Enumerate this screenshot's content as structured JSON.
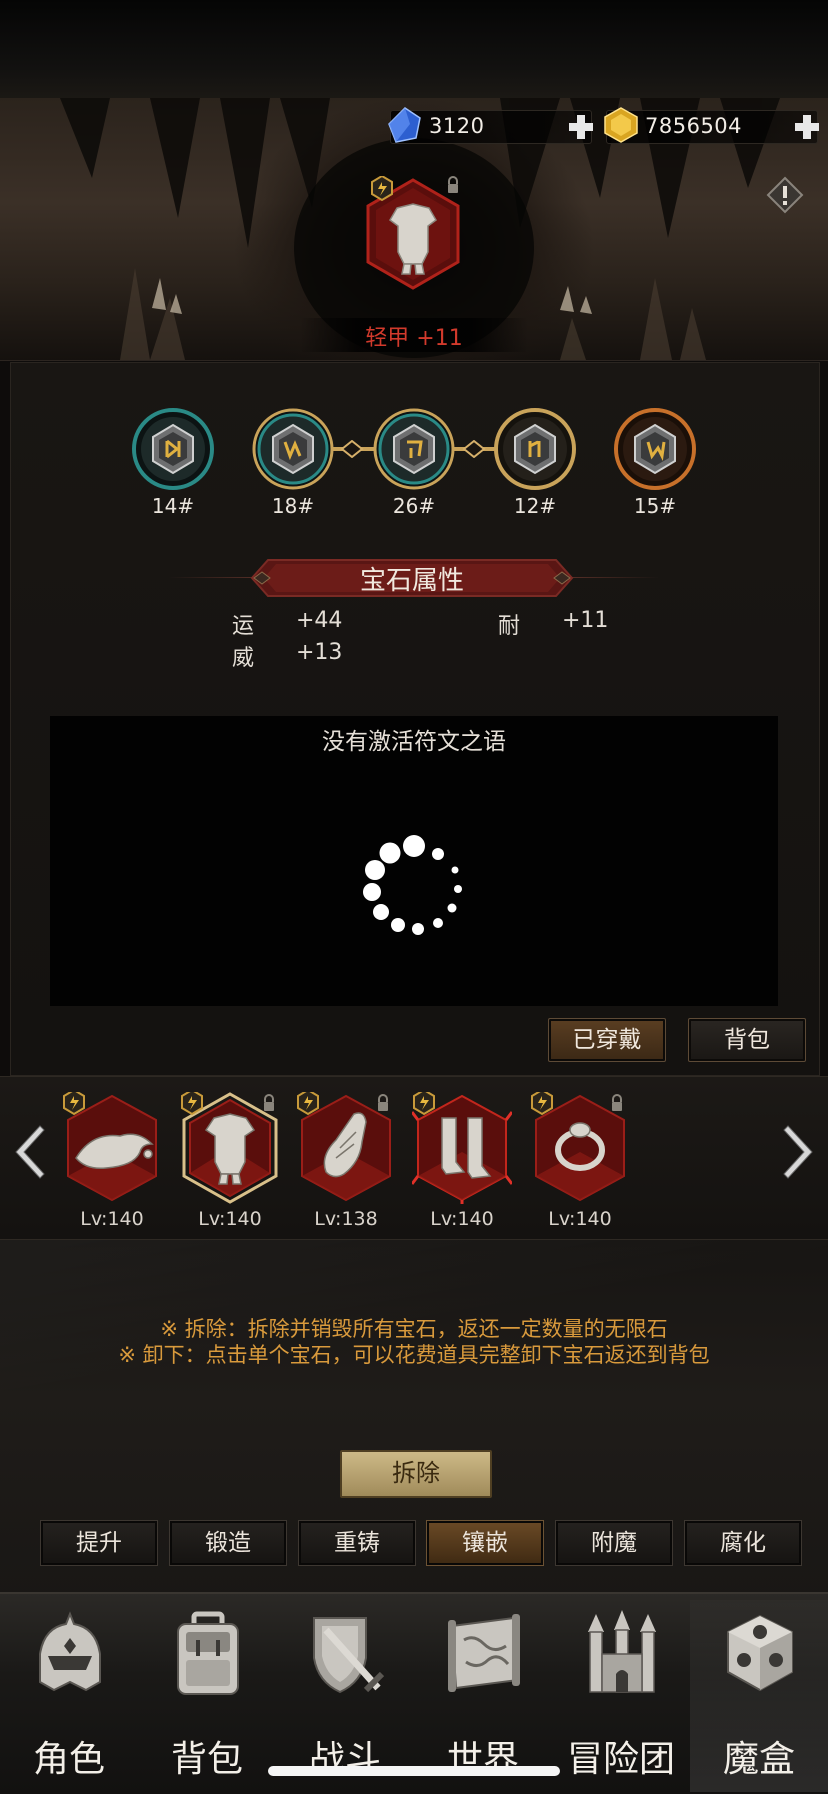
{
  "currency": {
    "diamond": {
      "value": "3120",
      "icon": "blue-crystal-icon"
    },
    "gold": {
      "value": "7856504",
      "icon": "gold-crystal-icon"
    }
  },
  "item": {
    "name": "轻甲 +11"
  },
  "gems": [
    {
      "label": "14#",
      "color": "#2a8a86"
    },
    {
      "label": "18#",
      "color": "#2a8a86"
    },
    {
      "label": "26#",
      "color": "#2a8a86"
    },
    {
      "label": "12#",
      "color": "#c9a35a"
    },
    {
      "label": "15#",
      "color": "#c7702a"
    }
  ],
  "gem_attributes": {
    "title": "宝石属性",
    "rows": [
      {
        "name": "运",
        "value": "+44"
      },
      {
        "name": "耐",
        "value": "+11"
      },
      {
        "name": "威",
        "value": "+13"
      }
    ]
  },
  "runes": {
    "text": "没有激活符文之语"
  },
  "buttons": {
    "equipped": "已穿戴",
    "bag": "背包",
    "remove": "拆除"
  },
  "equipment": [
    {
      "lv": "Lv:140",
      "icon": "wizard-hat-icon"
    },
    {
      "lv": "Lv:140",
      "icon": "chest-armor-icon"
    },
    {
      "lv": "Lv:138",
      "icon": "gauntlet-icon"
    },
    {
      "lv": "Lv:140",
      "icon": "boots-icon"
    },
    {
      "lv": "Lv:140",
      "icon": "ring-icon"
    }
  ],
  "notes": [
    "※ 拆除：拆除并销毁所有宝石，返还一定数量的无限石",
    "※ 卸下：点击单个宝石，可以花费道具完整卸下宝石返还到背包"
  ],
  "tabs": [
    {
      "label": "提升",
      "active": false
    },
    {
      "label": "锻造",
      "active": false
    },
    {
      "label": "重铸",
      "active": false
    },
    {
      "label": "镶嵌",
      "active": true
    },
    {
      "label": "附魔",
      "active": false
    },
    {
      "label": "腐化",
      "active": false
    }
  ],
  "nav": [
    {
      "label": "角色",
      "icon": "helmet-icon"
    },
    {
      "label": "背包",
      "icon": "backpack-icon"
    },
    {
      "label": "战斗",
      "icon": "sword-shield-icon"
    },
    {
      "label": "世界",
      "icon": "map-scroll-icon"
    },
    {
      "label": "冒险团",
      "icon": "castle-icon"
    },
    {
      "label": "魔盒",
      "icon": "magic-cube-icon"
    }
  ]
}
